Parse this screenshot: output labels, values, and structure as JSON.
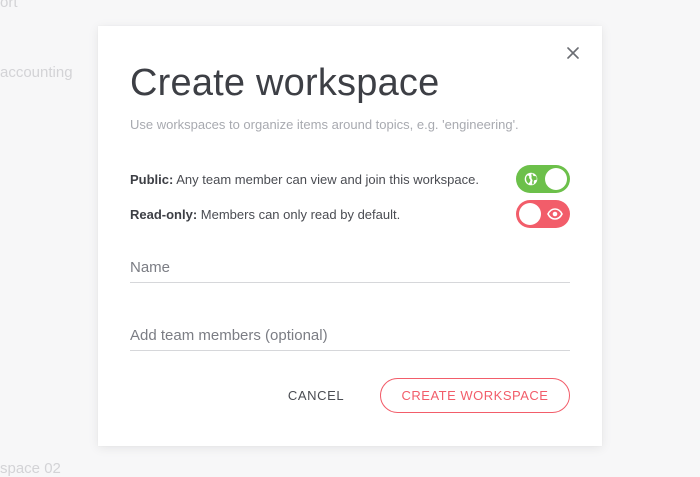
{
  "background": {
    "fragments": [
      "ort",
      "accounting",
      "space 02"
    ]
  },
  "modal": {
    "title": "Create workspace",
    "subtitle": "Use workspaces to organize items around topics, e.g. 'engineering'.",
    "close_icon": "close-icon",
    "settings": {
      "public": {
        "label": "Public:",
        "description": " Any team member can view and join this workspace.",
        "enabled": true,
        "color": "#6cc04a",
        "icon": "globe-icon"
      },
      "readonly": {
        "label": "Read-only:",
        "description": " Members can only read by default.",
        "enabled": false,
        "color": "#f25d6a",
        "icon": "eye-icon"
      }
    },
    "fields": {
      "name": {
        "placeholder": "Name",
        "value": ""
      },
      "members": {
        "placeholder": "Add team members (optional)",
        "value": ""
      }
    },
    "actions": {
      "cancel_label": "CANCEL",
      "create_label": "CREATE WORKSPACE",
      "accent_color": "#f25d6a"
    }
  }
}
